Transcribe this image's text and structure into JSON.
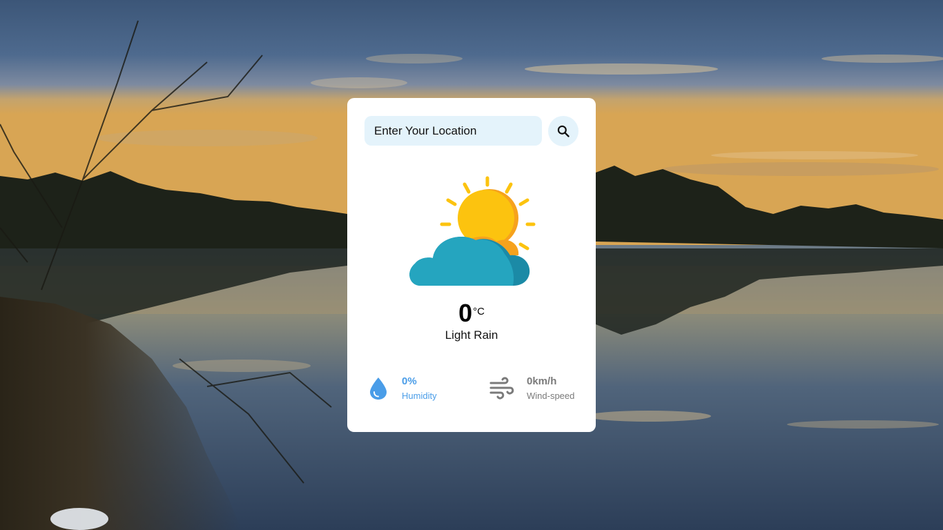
{
  "search": {
    "placeholder": "Enter Your Location",
    "button_icon": "search-icon"
  },
  "weather": {
    "icon": "partly-cloudy-icon",
    "temperature": "0",
    "unit": "°C",
    "condition": "Light Rain"
  },
  "stats": {
    "humidity": {
      "value": "0%",
      "label": "Humidity",
      "icon": "water-drop-icon",
      "color": "#4a9de8"
    },
    "wind": {
      "value": "0km/h",
      "label": "Wind-speed",
      "icon": "wind-icon",
      "color": "#7a7a7a"
    }
  },
  "colors": {
    "card_background": "#ffffff",
    "input_background": "#e4f3fb",
    "sun": "#fcc30f",
    "sun_shade": "#f6a21d",
    "cloud": "#25a5bf",
    "cloud_shade": "#1b8aa6"
  }
}
